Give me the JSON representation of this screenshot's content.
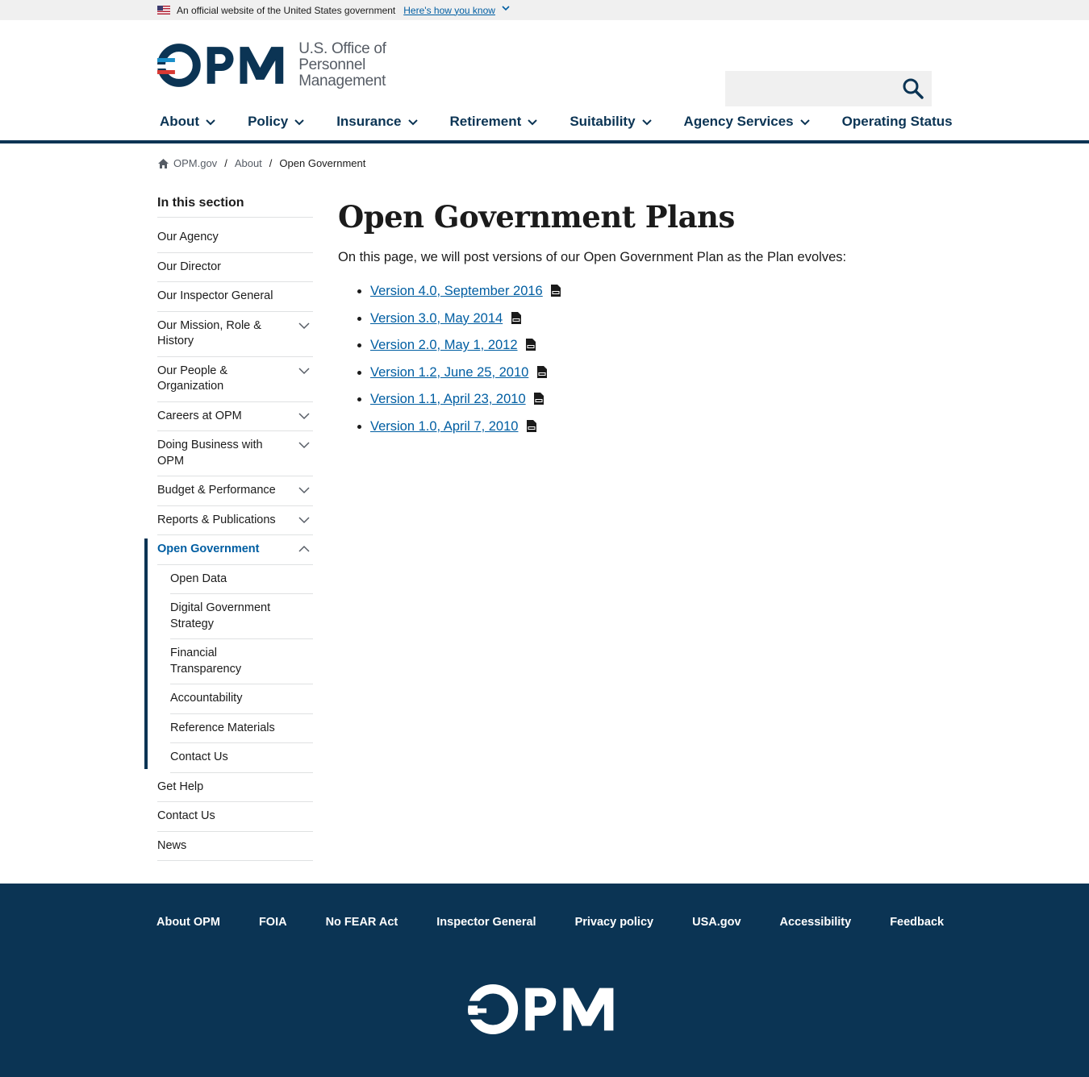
{
  "banner": {
    "text": "An official website of the United States government",
    "how_link": "Here's how you know"
  },
  "header": {
    "logo_text_line1": "U.S. Office of",
    "logo_text_line2": "Personnel Management",
    "search_placeholder": ""
  },
  "nav": {
    "items": [
      {
        "label": "About"
      },
      {
        "label": "Policy"
      },
      {
        "label": "Insurance"
      },
      {
        "label": "Retirement"
      },
      {
        "label": "Suitability"
      },
      {
        "label": "Agency Services"
      },
      {
        "label": "Operating Status"
      }
    ]
  },
  "breadcrumb": {
    "home": "OPM.gov",
    "parent": "About",
    "current": "Open Government"
  },
  "sidebar": {
    "heading": "In this section",
    "items": [
      {
        "label": "Our Agency"
      },
      {
        "label": "Our Director"
      },
      {
        "label": "Our Inspector General"
      },
      {
        "label": "Our Mission, Role & History"
      },
      {
        "label": "Our People & Organization"
      },
      {
        "label": "Careers at OPM"
      },
      {
        "label": "Doing Business with OPM"
      },
      {
        "label": "Budget & Performance"
      },
      {
        "label": "Reports & Publications"
      },
      {
        "label": "Open Government"
      },
      {
        "label": "Get Help"
      },
      {
        "label": "Contact Us"
      },
      {
        "label": "News"
      }
    ],
    "sub_items": [
      {
        "label": "Open Data"
      },
      {
        "label": "Digital Government Strategy"
      },
      {
        "label": "Financial Transparency"
      },
      {
        "label": "Accountability"
      },
      {
        "label": "Reference Materials"
      },
      {
        "label": "Contact Us"
      }
    ]
  },
  "main": {
    "title": "Open Government Plans",
    "intro": "On this page, we will post versions of our Open Government Plan as the Plan evolves:",
    "links": [
      {
        "label": "Version 4.0, September 2016"
      },
      {
        "label": "Version 3.0, May 2014"
      },
      {
        "label": "Version 2.0, May 1, 2012"
      },
      {
        "label": "Version 1.2, June 25, 2010"
      },
      {
        "label": "Version 1.1, April 23, 2010"
      },
      {
        "label": "Version 1.0, April 7, 2010"
      }
    ]
  },
  "footer": {
    "links": [
      {
        "label": "About OPM"
      },
      {
        "label": "FOIA"
      },
      {
        "label": "No FEAR Act"
      },
      {
        "label": "Inspector General"
      },
      {
        "label": "Privacy policy"
      },
      {
        "label": "USA.gov"
      },
      {
        "label": "Accessibility"
      },
      {
        "label": "Feedback"
      }
    ]
  },
  "colors": {
    "navy": "#0b3454",
    "link_blue": "#005ea2",
    "accent_cyan": "#1a8fc9",
    "logo_red": "#d83933",
    "banner_gray": "#f0f0f0"
  },
  "icons": [
    "us-flag-icon",
    "chevron-down-icon",
    "search-icon",
    "home-icon",
    "pdf-icon",
    "chevron-up-icon"
  ]
}
